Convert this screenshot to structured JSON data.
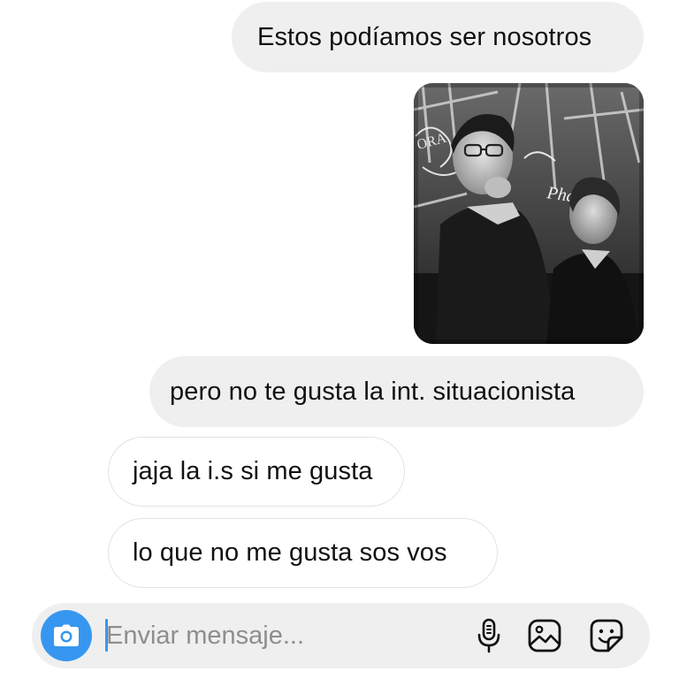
{
  "conversation": {
    "messages": [
      {
        "direction": "outgoing",
        "type": "text",
        "text": "Estos podíamos ser nosotros"
      },
      {
        "direction": "outgoing",
        "type": "photo",
        "photo_text": "Phantom"
      },
      {
        "direction": "outgoing",
        "type": "text",
        "text": "pero no te gusta la int. situacionista"
      },
      {
        "direction": "incoming",
        "type": "text",
        "text": "jaja la i.s si me gusta"
      },
      {
        "direction": "incoming",
        "type": "text",
        "text": "lo que no me gusta sos vos"
      }
    ]
  },
  "composer": {
    "placeholder": "Enviar mensaje...",
    "value": "",
    "camera_icon": "camera-icon",
    "mic_icon": "microphone-icon",
    "gallery_icon": "gallery-icon",
    "sticker_icon": "sticker-icon"
  },
  "colors": {
    "outgoing_bubble": "#efefef",
    "incoming_border": "#e3e3e3",
    "accent": "#3797f0",
    "placeholder": "#8e8e8e"
  }
}
